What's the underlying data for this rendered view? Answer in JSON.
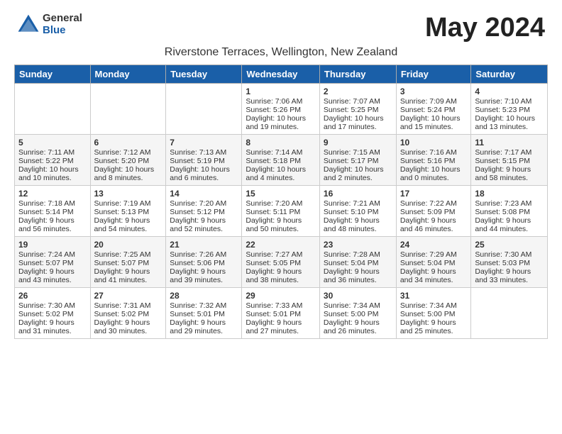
{
  "header": {
    "logo_general": "General",
    "logo_blue": "Blue",
    "month_title": "May 2024",
    "location": "Riverstone Terraces, Wellington, New Zealand"
  },
  "weekdays": [
    "Sunday",
    "Monday",
    "Tuesday",
    "Wednesday",
    "Thursday",
    "Friday",
    "Saturday"
  ],
  "weeks": [
    [
      {
        "day": "",
        "sunrise": "",
        "sunset": "",
        "daylight": ""
      },
      {
        "day": "",
        "sunrise": "",
        "sunset": "",
        "daylight": ""
      },
      {
        "day": "",
        "sunrise": "",
        "sunset": "",
        "daylight": ""
      },
      {
        "day": "1",
        "sunrise": "Sunrise: 7:06 AM",
        "sunset": "Sunset: 5:26 PM",
        "daylight": "Daylight: 10 hours and 19 minutes."
      },
      {
        "day": "2",
        "sunrise": "Sunrise: 7:07 AM",
        "sunset": "Sunset: 5:25 PM",
        "daylight": "Daylight: 10 hours and 17 minutes."
      },
      {
        "day": "3",
        "sunrise": "Sunrise: 7:09 AM",
        "sunset": "Sunset: 5:24 PM",
        "daylight": "Daylight: 10 hours and 15 minutes."
      },
      {
        "day": "4",
        "sunrise": "Sunrise: 7:10 AM",
        "sunset": "Sunset: 5:23 PM",
        "daylight": "Daylight: 10 hours and 13 minutes."
      }
    ],
    [
      {
        "day": "5",
        "sunrise": "Sunrise: 7:11 AM",
        "sunset": "Sunset: 5:22 PM",
        "daylight": "Daylight: 10 hours and 10 minutes."
      },
      {
        "day": "6",
        "sunrise": "Sunrise: 7:12 AM",
        "sunset": "Sunset: 5:20 PM",
        "daylight": "Daylight: 10 hours and 8 minutes."
      },
      {
        "day": "7",
        "sunrise": "Sunrise: 7:13 AM",
        "sunset": "Sunset: 5:19 PM",
        "daylight": "Daylight: 10 hours and 6 minutes."
      },
      {
        "day": "8",
        "sunrise": "Sunrise: 7:14 AM",
        "sunset": "Sunset: 5:18 PM",
        "daylight": "Daylight: 10 hours and 4 minutes."
      },
      {
        "day": "9",
        "sunrise": "Sunrise: 7:15 AM",
        "sunset": "Sunset: 5:17 PM",
        "daylight": "Daylight: 10 hours and 2 minutes."
      },
      {
        "day": "10",
        "sunrise": "Sunrise: 7:16 AM",
        "sunset": "Sunset: 5:16 PM",
        "daylight": "Daylight: 10 hours and 0 minutes."
      },
      {
        "day": "11",
        "sunrise": "Sunrise: 7:17 AM",
        "sunset": "Sunset: 5:15 PM",
        "daylight": "Daylight: 9 hours and 58 minutes."
      }
    ],
    [
      {
        "day": "12",
        "sunrise": "Sunrise: 7:18 AM",
        "sunset": "Sunset: 5:14 PM",
        "daylight": "Daylight: 9 hours and 56 minutes."
      },
      {
        "day": "13",
        "sunrise": "Sunrise: 7:19 AM",
        "sunset": "Sunset: 5:13 PM",
        "daylight": "Daylight: 9 hours and 54 minutes."
      },
      {
        "day": "14",
        "sunrise": "Sunrise: 7:20 AM",
        "sunset": "Sunset: 5:12 PM",
        "daylight": "Daylight: 9 hours and 52 minutes."
      },
      {
        "day": "15",
        "sunrise": "Sunrise: 7:20 AM",
        "sunset": "Sunset: 5:11 PM",
        "daylight": "Daylight: 9 hours and 50 minutes."
      },
      {
        "day": "16",
        "sunrise": "Sunrise: 7:21 AM",
        "sunset": "Sunset: 5:10 PM",
        "daylight": "Daylight: 9 hours and 48 minutes."
      },
      {
        "day": "17",
        "sunrise": "Sunrise: 7:22 AM",
        "sunset": "Sunset: 5:09 PM",
        "daylight": "Daylight: 9 hours and 46 minutes."
      },
      {
        "day": "18",
        "sunrise": "Sunrise: 7:23 AM",
        "sunset": "Sunset: 5:08 PM",
        "daylight": "Daylight: 9 hours and 44 minutes."
      }
    ],
    [
      {
        "day": "19",
        "sunrise": "Sunrise: 7:24 AM",
        "sunset": "Sunset: 5:07 PM",
        "daylight": "Daylight: 9 hours and 43 minutes."
      },
      {
        "day": "20",
        "sunrise": "Sunrise: 7:25 AM",
        "sunset": "Sunset: 5:07 PM",
        "daylight": "Daylight: 9 hours and 41 minutes."
      },
      {
        "day": "21",
        "sunrise": "Sunrise: 7:26 AM",
        "sunset": "Sunset: 5:06 PM",
        "daylight": "Daylight: 9 hours and 39 minutes."
      },
      {
        "day": "22",
        "sunrise": "Sunrise: 7:27 AM",
        "sunset": "Sunset: 5:05 PM",
        "daylight": "Daylight: 9 hours and 38 minutes."
      },
      {
        "day": "23",
        "sunrise": "Sunrise: 7:28 AM",
        "sunset": "Sunset: 5:04 PM",
        "daylight": "Daylight: 9 hours and 36 minutes."
      },
      {
        "day": "24",
        "sunrise": "Sunrise: 7:29 AM",
        "sunset": "Sunset: 5:04 PM",
        "daylight": "Daylight: 9 hours and 34 minutes."
      },
      {
        "day": "25",
        "sunrise": "Sunrise: 7:30 AM",
        "sunset": "Sunset: 5:03 PM",
        "daylight": "Daylight: 9 hours and 33 minutes."
      }
    ],
    [
      {
        "day": "26",
        "sunrise": "Sunrise: 7:30 AM",
        "sunset": "Sunset: 5:02 PM",
        "daylight": "Daylight: 9 hours and 31 minutes."
      },
      {
        "day": "27",
        "sunrise": "Sunrise: 7:31 AM",
        "sunset": "Sunset: 5:02 PM",
        "daylight": "Daylight: 9 hours and 30 minutes."
      },
      {
        "day": "28",
        "sunrise": "Sunrise: 7:32 AM",
        "sunset": "Sunset: 5:01 PM",
        "daylight": "Daylight: 9 hours and 29 minutes."
      },
      {
        "day": "29",
        "sunrise": "Sunrise: 7:33 AM",
        "sunset": "Sunset: 5:01 PM",
        "daylight": "Daylight: 9 hours and 27 minutes."
      },
      {
        "day": "30",
        "sunrise": "Sunrise: 7:34 AM",
        "sunset": "Sunset: 5:00 PM",
        "daylight": "Daylight: 9 hours and 26 minutes."
      },
      {
        "day": "31",
        "sunrise": "Sunrise: 7:34 AM",
        "sunset": "Sunset: 5:00 PM",
        "daylight": "Daylight: 9 hours and 25 minutes."
      },
      {
        "day": "",
        "sunrise": "",
        "sunset": "",
        "daylight": ""
      }
    ]
  ]
}
